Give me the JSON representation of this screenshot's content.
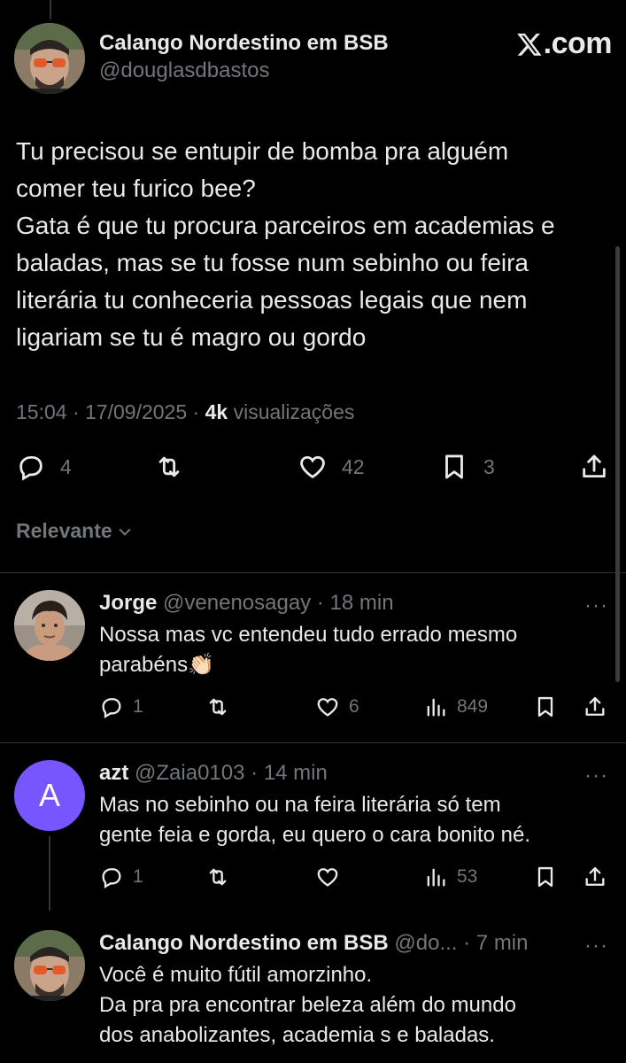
{
  "brand": {
    "logo_text": ".com"
  },
  "main_tweet": {
    "author_name": "Calango Nordestino em BSB",
    "author_handle": "@douglasdbastos",
    "text": "Tu precisou se entupir de bomba pra alguém\ncomer teu furico bee?\nGata é que tu procura parceiros em academias e\nbaladas, mas se tu fosse num sebinho ou feira\nliterária tu conheceria pessoas legais que nem\nligariam se tu é magro ou gordo",
    "time": "15:04",
    "date": "17/09/2025",
    "views_count": "4k",
    "views_label": "visualizações",
    "replies": "4",
    "likes": "42",
    "bookmarks": "3"
  },
  "sort": {
    "label": "Relevante"
  },
  "replies": [
    {
      "name": "Jorge",
      "handle": "@venenosagay",
      "time": "18 min",
      "text": "Nossa mas vc entendeu tudo errado mesmo\nparabéns👏🏻",
      "replies": "1",
      "likes": "6",
      "views": "849"
    },
    {
      "name": "azt",
      "handle": "@Zaia0103",
      "time": "14 min",
      "avatar_letter": "A",
      "text": "Mas no sebinho ou na feira literária só tem\ngente feia e gorda, eu quero o cara bonito né.",
      "replies": "1",
      "views": "53"
    },
    {
      "name": "Calango Nordestino em BSB",
      "handle": "@do...",
      "time": "7 min",
      "text": "Você é muito fútil amorzinho.\nDa pra pra encontrar beleza além do mundo\ndos anabolizantes, academia s e baladas."
    }
  ],
  "colors": {
    "background": "#000000",
    "text": "#e7e9ea",
    "muted": "#71767b",
    "divider": "#2f3336",
    "letter_avatar": "#7856ff"
  }
}
